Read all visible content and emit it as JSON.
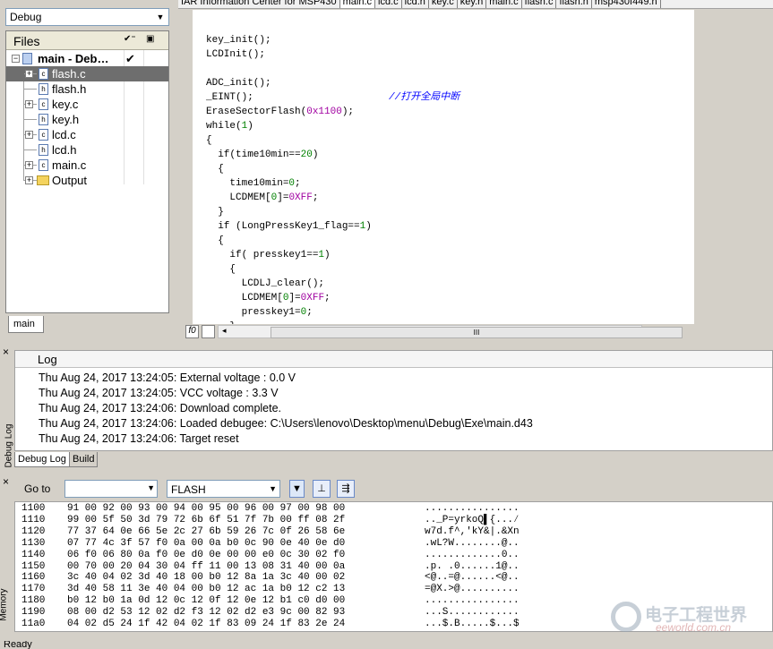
{
  "workspace": {
    "config": "Debug",
    "files_header": "Files",
    "tree": [
      {
        "label": "main - Deb…",
        "check": "✔",
        "type": "project"
      },
      {
        "label": "flash.c",
        "type": "c",
        "expandable": true,
        "selected": true
      },
      {
        "label": "flash.h",
        "type": "h",
        "expandable": false
      },
      {
        "label": "key.c",
        "type": "c",
        "expandable": true
      },
      {
        "label": "key.h",
        "type": "h",
        "expandable": false
      },
      {
        "label": "lcd.c",
        "type": "c",
        "expandable": true
      },
      {
        "label": "lcd.h",
        "type": "h",
        "expandable": false
      },
      {
        "label": "main.c",
        "type": "c",
        "expandable": true
      },
      {
        "label": "Output",
        "type": "folder",
        "expandable": true
      }
    ],
    "bottom_tab": "main"
  },
  "editor": {
    "tabs": [
      "IAR Information Center for MSP430",
      "main.c",
      "lcd.c",
      "lcd.h",
      "key.c",
      "key.h",
      "main.c",
      "flash.c",
      "flash.h",
      "msp430f449.h"
    ],
    "active_tab": 1,
    "code": [
      {
        "text": "key_init();"
      },
      {
        "text": "LCDInit();"
      },
      {
        "text": ""
      },
      {
        "text": "ADC_init();"
      },
      {
        "text": "_EINT();",
        "comment": "//打开全局中断"
      },
      {
        "text": "EraseSectorFlash(0x1100);"
      },
      {
        "text": "while(1)"
      },
      {
        "text": "{"
      },
      {
        "text": "  if(time10min==20)"
      },
      {
        "text": "  {"
      },
      {
        "text": "    time10min=0;"
      },
      {
        "text": "    LCDMEM[0]=0XFF;"
      },
      {
        "text": "  }"
      },
      {
        "text": "  if (LongPressKey1_flag==1)"
      },
      {
        "text": "  {"
      },
      {
        "text": "    if( presskey1==1)"
      },
      {
        "text": "    {"
      },
      {
        "text": "      LCDLJ_clear();"
      },
      {
        "text": "      LCDMEM[0]=0XFF;"
      },
      {
        "text": "      presskey1=0;"
      },
      {
        "text": "    }"
      }
    ],
    "scroll_btn1": "f0",
    "thumb_grip": "III"
  },
  "debug_log": {
    "title": "Log",
    "side_label": "Debug Log",
    "lines": [
      "Thu Aug 24, 2017 13:24:05: External voltage : 0.0 V",
      "Thu Aug 24, 2017 13:24:05: VCC voltage : 3.3 V",
      "Thu Aug 24, 2017 13:24:06: Download complete.",
      "Thu Aug 24, 2017 13:24:06: Loaded debugee: C:\\Users\\lenovo\\Desktop\\menu\\Debug\\Exe\\main.d43",
      "Thu Aug 24, 2017 13:24:06: Target reset"
    ],
    "tabs": [
      "Debug Log",
      "Build"
    ]
  },
  "memory": {
    "side_label": "Memory",
    "goto_label": "Go to",
    "goto_value": "",
    "zone": "FLASH",
    "rows": [
      {
        "addr": "1100",
        "hex": "91 00 92 00 93 00 94 00 95 00 96 00 97 00 98 00",
        "ascii": "................"
      },
      {
        "addr": "1110",
        "hex": "99 00 5f 50 3d 79 72 6b 6f 51 7f 7b 00 ff 08 2f",
        "ascii": ".._P=yrkoQ▌{...⁄"
      },
      {
        "addr": "1120",
        "hex": "77 37 64 0e 66 5e 2c 27 6b 59 26 7c 0f 26 58 6e",
        "ascii": "w7d.f^,'kY&|.&Xn"
      },
      {
        "addr": "1130",
        "hex": "07 77 4c 3f 57 f0 0a 00 0a b0 0c 90 0e 40 0e d0",
        "ascii": ".wL?W........@.."
      },
      {
        "addr": "1140",
        "hex": "06 f0 06 80 0a f0 0e d0 0e 00 00 e0 0c 30 02 f0",
        "ascii": ".............0.."
      },
      {
        "addr": "1150",
        "hex": "00 70 00 20 04 30 04 ff 11 00 13 08 31 40 00 0a",
        "ascii": ".p. .0......1@.."
      },
      {
        "addr": "1160",
        "hex": "3c 40 04 02 3d 40 18 00 b0 12 8a 1a 3c 40 00 02",
        "ascii": "<@..=@......<@.."
      },
      {
        "addr": "1170",
        "hex": "3d 40 58 11 3e 40 04 00 b0 12 ac 1a b0 12 c2 13",
        "ascii": "=@X.>@.........."
      },
      {
        "addr": "1180",
        "hex": "b0 12 b0 1a 0d 12 0c 12 0f 12 0e 12 b1 c0 d0 00",
        "ascii": "................"
      },
      {
        "addr": "1190",
        "hex": "08 00 d2 53 12 02 d2 f3 12 02 d2 e3 9c 00 82 93",
        "ascii": "...S............"
      },
      {
        "addr": "11a0",
        "hex": "04 02 d5 24 1f 42 04 02 1f 83 09 24 1f 83 2e 24",
        "ascii": "...$.B.....$...$"
      }
    ]
  },
  "status": "Ready",
  "watermark": {
    "title": "电子工程世界",
    "sub": "eeworld.com.cn"
  }
}
